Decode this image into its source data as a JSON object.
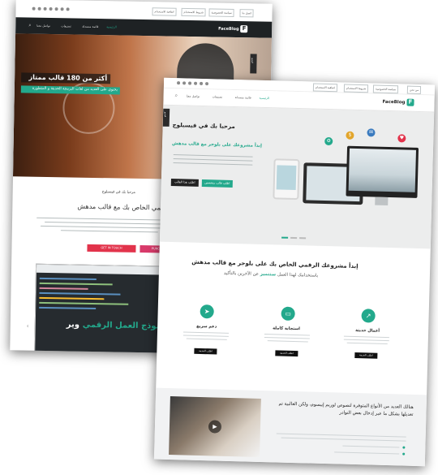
{
  "colors": {
    "accent": "#23a98c",
    "dark": "#222222",
    "red": "#e2334b",
    "pink": "#d83a6a"
  },
  "icons": [
    "rss-icon",
    "twitter-icon",
    "facebook-icon",
    "gplus-icon",
    "youtube-icon",
    "pinterest-icon",
    "instagram-icon",
    "search-icon",
    "play-icon",
    "rocket-icon",
    "laptop-icon",
    "chart-icon",
    "mobile-icon",
    "gear-icon",
    "cart-icon"
  ],
  "back": {
    "topbar": {
      "buttons": [
        "اتصل بنا",
        "سياسة الخصوصية",
        "شروط الاستخدام",
        "اتفاقية الاستخدام"
      ]
    },
    "brand": "FaceBlog",
    "nav": [
      "الرئيسية",
      "قائمة منسدلة",
      "تصنيفات",
      "تواصل معنا"
    ],
    "slide_tag": "فيديو",
    "hero_title": "أكثر من 180 قالب ممتاز",
    "hero_sub": "يحتوي على العديد من لغات البرمجة الحديثة و المتطورة",
    "welcome": "مرحبا بك في فيسبلوج",
    "section_title": "الرقمي الخاص بك مع قالب مدهش",
    "btn_touch": "GET IN TOUCH",
    "btn_purchase": "PURCHASE",
    "code_title": "نموذج العمل الرقمي",
    "code_title_start": "وير"
  },
  "front": {
    "topbar": {
      "buttons": [
        "من نحن",
        "سياسة الخصوصية",
        "شروط الاستخدام",
        "اتفاقية الاستخدام"
      ]
    },
    "brand": "FaceBlog",
    "nav": [
      "الرئيسية",
      "قائمة منسدلة",
      "تصنيفات",
      "تواصل معنا"
    ],
    "search_label": "بحث",
    "slide_tag": "فيديو",
    "hero_title": "مرحبا بك في فيسبلوج",
    "hero_sub": "إبدأ مشروعك على بلوجر مع قالب مدهش",
    "hero_btn_primary": "اطلب هذا القالب",
    "hero_btn_secondary": "اطلب قالب متخصص",
    "section_title": "إبدأ مشروعك الرقمي الخاص بك على بلوجر مع قالب مدهش",
    "section_sub_start": "باستخدامك لهذا العمل",
    "section_sub_highlight": "ستتميز",
    "section_sub_end": "عن الآخرين بالتأكيد",
    "features": [
      {
        "title": "أعمال حديثة",
        "btn": "اطلب الخدمة"
      },
      {
        "title": "استجابة كاملة",
        "btn": "اطلب الخدمة"
      },
      {
        "title": "دعم سريع",
        "btn": "اطلب الخدمة"
      }
    ],
    "bottom_text": "هنالك العديد من الأنواع المتوفرة لنصوص لوريم إيبسوم، ولكن الغالبية تم تعديلها بشكل ما عبر إدخال بعض النوادر"
  }
}
